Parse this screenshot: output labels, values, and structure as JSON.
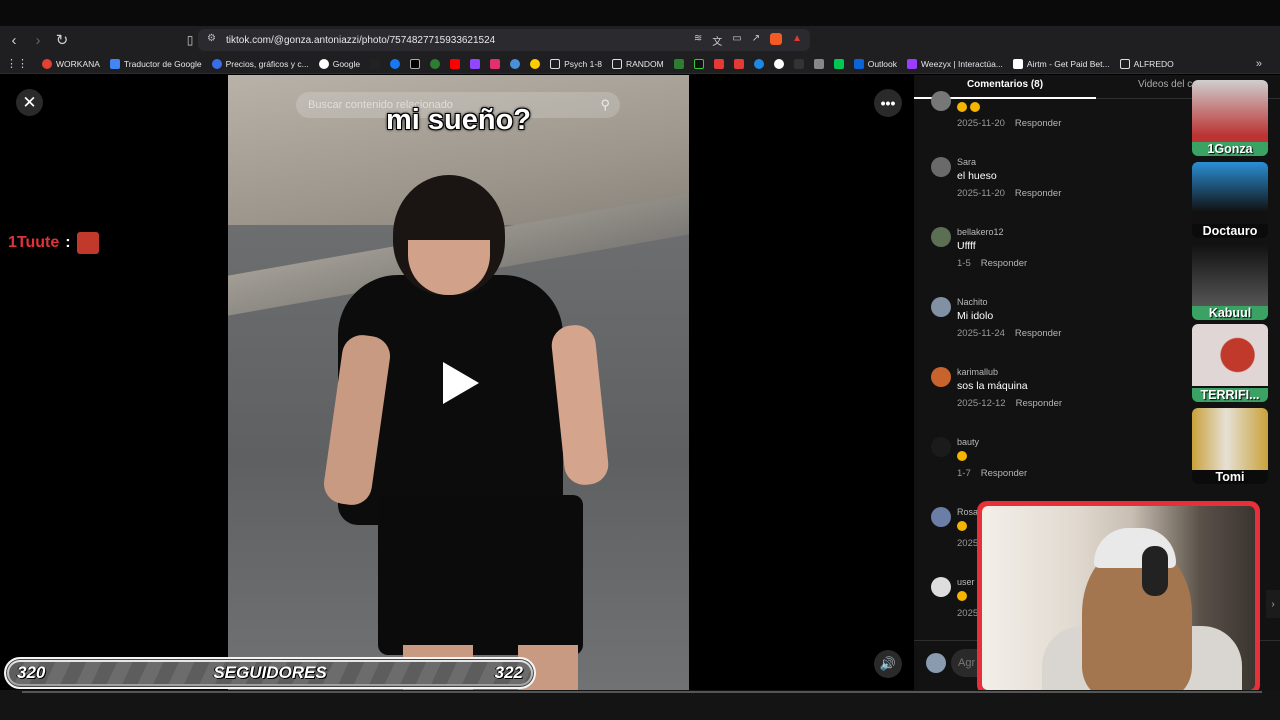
{
  "browser": {
    "url": "tiktok.com/@gonza.antoniazzi/photo/7574827715933621524",
    "bookmarks": [
      "WORKANA",
      "Traductor de Google",
      "Precios, gráficos y c...",
      "Google",
      "Psych 1-8",
      "RANDOM",
      "Outlook",
      "Weezyx | Interactúa...",
      "Airtm - Get Paid Bet...",
      "ALFREDO"
    ],
    "bookmark_colors": [
      "#e34133",
      "#4285f4",
      "#3a6ee8",
      "#ffffff",
      "#ffcc00",
      "#ffcc00",
      "#0a64d6",
      "#9b3bff",
      "#ffffff",
      "#ffcc00"
    ]
  },
  "overlay": {
    "chat_user": "1Tuute",
    "chat_colon": ":",
    "followers_left": "320",
    "followers_label": "SEGUIDORES",
    "followers_right": "322",
    "streamers": [
      "1Gonza",
      "Doctauro",
      "Kabuul",
      "TERRIFI...",
      "Tomi"
    ]
  },
  "video": {
    "search_placeholder": "Buscar contenido relacionado",
    "caption": "mi sueño?"
  },
  "comments_panel": {
    "tab_comments": "Comentarios (8)",
    "tab_videos": "Videos del c",
    "add_placeholder": "Agr",
    "reply_label": "Responder",
    "comments": [
      {
        "user": "",
        "text": "",
        "emoji_count": 2,
        "date": "2025-11-20",
        "avatar_color": "#777777"
      },
      {
        "user": "Sara",
        "text": "el hueso",
        "emoji_count": 0,
        "date": "2025-11-20",
        "avatar_color": "#6a6a6a"
      },
      {
        "user": "bellakero12",
        "text": "Uffff",
        "emoji_count": 0,
        "date": "1-5",
        "avatar_color": "#5c6f55"
      },
      {
        "user": "Nachito",
        "text": "Mi idolo",
        "emoji_count": 0,
        "date": "2025-11-24",
        "avatar_color": "#8190a3"
      },
      {
        "user": "karimallub",
        "text": "sos la máquina",
        "emoji_count": 0,
        "date": "2025-12-12",
        "avatar_color": "#c7642e"
      },
      {
        "user": "bauty",
        "text": "",
        "emoji_count": 1,
        "date": "1-7",
        "avatar_color": "#1b1b1b"
      },
      {
        "user": "Rosa",
        "text": "",
        "emoji_count": 1,
        "date": "2025",
        "avatar_color": "#6b7ea8"
      },
      {
        "user": "user",
        "text": "",
        "emoji_count": 1,
        "date": "2025",
        "avatar_color": "#dddddd"
      }
    ]
  },
  "colors": {
    "accent_red": "#e0323a",
    "green_label": "#3aa364",
    "panel_bg": "#121212"
  }
}
